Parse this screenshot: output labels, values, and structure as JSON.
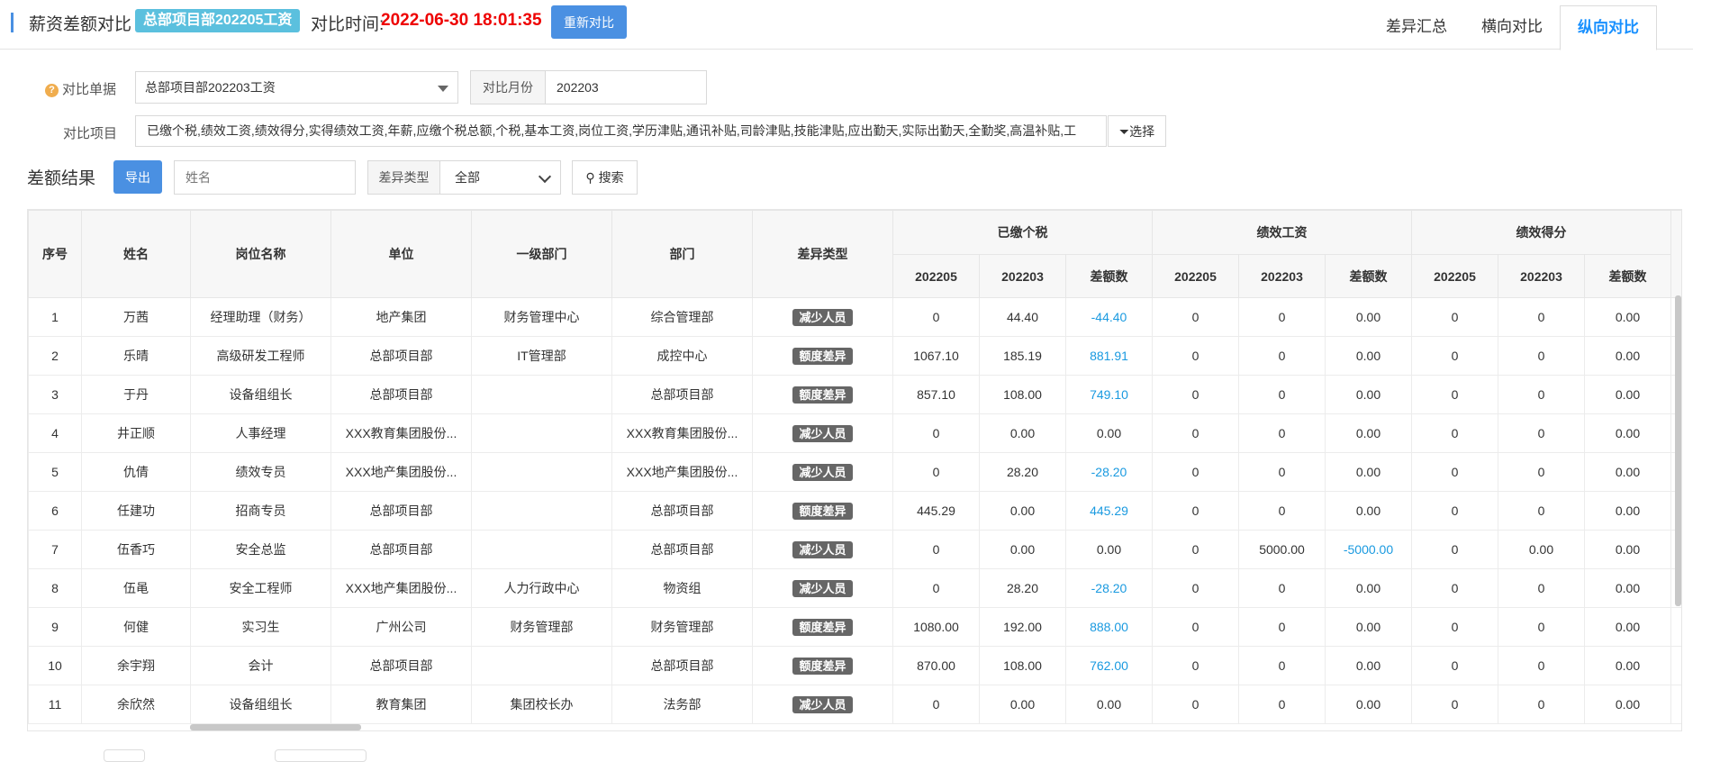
{
  "header": {
    "title": "薪资差额对比",
    "badge": "总部项目部202205工资",
    "time_label": "对比时间:",
    "time_value": "2022-06-30 18:01:35",
    "rerun_button": "重新对比",
    "tabs": [
      {
        "label": "差异汇总",
        "active": false
      },
      {
        "label": "横向对比",
        "active": false
      },
      {
        "label": "纵向对比",
        "active": true
      }
    ]
  },
  "form": {
    "doc_label": "对比单据",
    "doc_value": "总部项目部202203工资",
    "month_label": "对比月份",
    "month_value": "202203",
    "items_label": "对比项目",
    "items_value": "已缴个税,绩效工资,绩效得分,实得绩效工资,年薪,应缴个税总额,个税,基本工资,岗位工资,学历津贴,通讯补贴,司龄津贴,技能津贴,应出勤天,实际出勤天,全勤奖,高温补贴,工",
    "choose_button": "选择"
  },
  "results": {
    "title": "差额结果",
    "export_button": "导出",
    "name_placeholder": "姓名",
    "type_label": "差异类型",
    "type_value": "全部",
    "search_button": "搜索"
  },
  "table": {
    "fixed_headers": [
      "序号",
      "姓名",
      "岗位名称",
      "单位",
      "一级部门",
      "部门",
      "差异类型"
    ],
    "groups": [
      "已缴个税",
      "绩效工资",
      "绩效得分"
    ],
    "sub_headers": [
      "202205",
      "202203",
      "差额数"
    ],
    "rows": [
      {
        "no": "1",
        "name": "万茜",
        "post": "经理助理（财务）",
        "unit": "地产集团",
        "dept1": "财务管理中心",
        "dept": "综合管理部",
        "type": "减少人员",
        "v": [
          "0",
          "44.40",
          "-44.40",
          "0",
          "0",
          "0.00",
          "0",
          "0",
          "0.00"
        ],
        "hl": [
          2
        ]
      },
      {
        "no": "2",
        "name": "乐晴",
        "post": "高级研发工程师",
        "unit": "总部项目部",
        "dept1": "IT管理部",
        "dept": "成控中心",
        "type": "额度差异",
        "v": [
          "1067.10",
          "185.19",
          "881.91",
          "0",
          "0",
          "0.00",
          "0",
          "0",
          "0.00"
        ],
        "hl": [
          2
        ]
      },
      {
        "no": "3",
        "name": "于丹",
        "post": "设备组组长",
        "unit": "总部项目部",
        "dept1": "",
        "dept": "总部项目部",
        "type": "额度差异",
        "v": [
          "857.10",
          "108.00",
          "749.10",
          "0",
          "0",
          "0.00",
          "0",
          "0",
          "0.00"
        ],
        "hl": [
          2
        ]
      },
      {
        "no": "4",
        "name": "井正顺",
        "post": "人事经理",
        "unit": "XXX教育集团股份...",
        "dept1": "",
        "dept": "XXX教育集团股份...",
        "type": "减少人员",
        "v": [
          "0",
          "0.00",
          "0.00",
          "0",
          "0",
          "0.00",
          "0",
          "0",
          "0.00"
        ],
        "hl": []
      },
      {
        "no": "5",
        "name": "仇倩",
        "post": "绩效专员",
        "unit": "XXX地产集团股份...",
        "dept1": "",
        "dept": "XXX地产集团股份...",
        "type": "减少人员",
        "v": [
          "0",
          "28.20",
          "-28.20",
          "0",
          "0",
          "0.00",
          "0",
          "0",
          "0.00"
        ],
        "hl": [
          2
        ]
      },
      {
        "no": "6",
        "name": "任建功",
        "post": "招商专员",
        "unit": "总部项目部",
        "dept1": "",
        "dept": "总部项目部",
        "type": "额度差异",
        "v": [
          "445.29",
          "0.00",
          "445.29",
          "0",
          "0",
          "0.00",
          "0",
          "0",
          "0.00"
        ],
        "hl": [
          2
        ]
      },
      {
        "no": "7",
        "name": "伍香巧",
        "post": "安全总监",
        "unit": "总部项目部",
        "dept1": "",
        "dept": "总部项目部",
        "type": "减少人员",
        "v": [
          "0",
          "0.00",
          "0.00",
          "0",
          "5000.00",
          "-5000.00",
          "0",
          "0.00",
          "0.00"
        ],
        "hl": [
          5
        ]
      },
      {
        "no": "8",
        "name": "伍黾",
        "post": "安全工程师",
        "unit": "XXX地产集团股份...",
        "dept1": "人力行政中心",
        "dept": "物资组",
        "type": "减少人员",
        "v": [
          "0",
          "28.20",
          "-28.20",
          "0",
          "0",
          "0.00",
          "0",
          "0",
          "0.00"
        ],
        "hl": [
          2
        ]
      },
      {
        "no": "9",
        "name": "何健",
        "post": "实习生",
        "unit": "广州公司",
        "dept1": "财务管理部",
        "dept": "财务管理部",
        "type": "额度差异",
        "v": [
          "1080.00",
          "192.00",
          "888.00",
          "0",
          "0",
          "0.00",
          "0",
          "0",
          "0.00"
        ],
        "hl": [
          2
        ]
      },
      {
        "no": "10",
        "name": "余宇翔",
        "post": "会计",
        "unit": "总部项目部",
        "dept1": "",
        "dept": "总部项目部",
        "type": "额度差异",
        "v": [
          "870.00",
          "108.00",
          "762.00",
          "0",
          "0",
          "0.00",
          "0",
          "0",
          "0.00"
        ],
        "hl": [
          2
        ]
      },
      {
        "no": "11",
        "name": "余欣然",
        "post": "设备组组长",
        "unit": "教育集团",
        "dept1": "集团校长办",
        "dept": "法务部",
        "type": "减少人员",
        "v": [
          "0",
          "0.00",
          "0.00",
          "0",
          "0",
          "0.00",
          "0",
          "0",
          "0.00"
        ],
        "hl": []
      }
    ]
  },
  "colors": {
    "primary": "#4a90e2",
    "badge": "#5bc0de",
    "time": "#ee0000",
    "diff": "#1a9ae0",
    "tag": "#666666"
  }
}
